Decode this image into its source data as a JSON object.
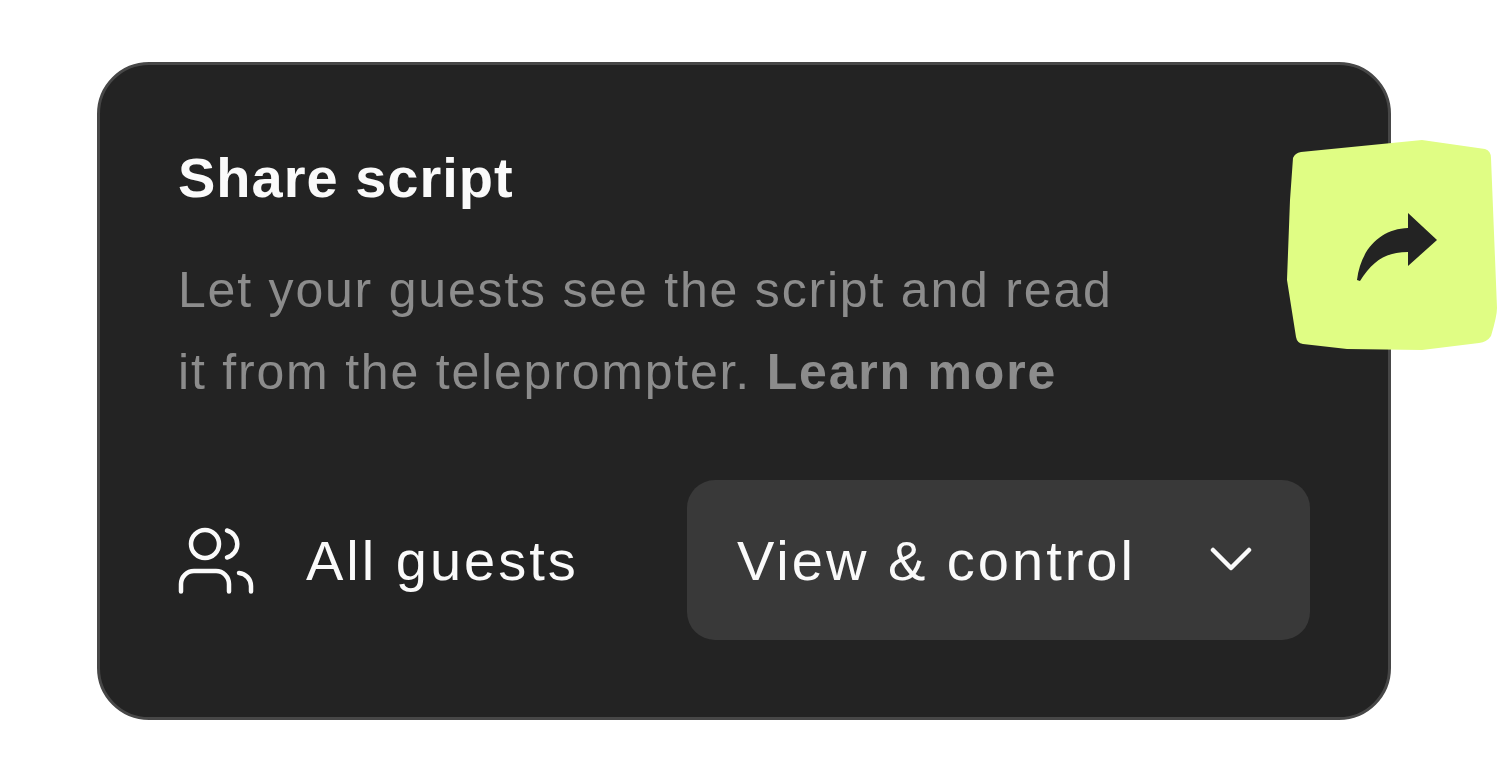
{
  "card": {
    "title": "Share script",
    "description": "Let your guests see the script and read it from the teleprompter.",
    "link": "Learn more"
  },
  "access": {
    "audience": "All guests",
    "permission": "View & control"
  }
}
